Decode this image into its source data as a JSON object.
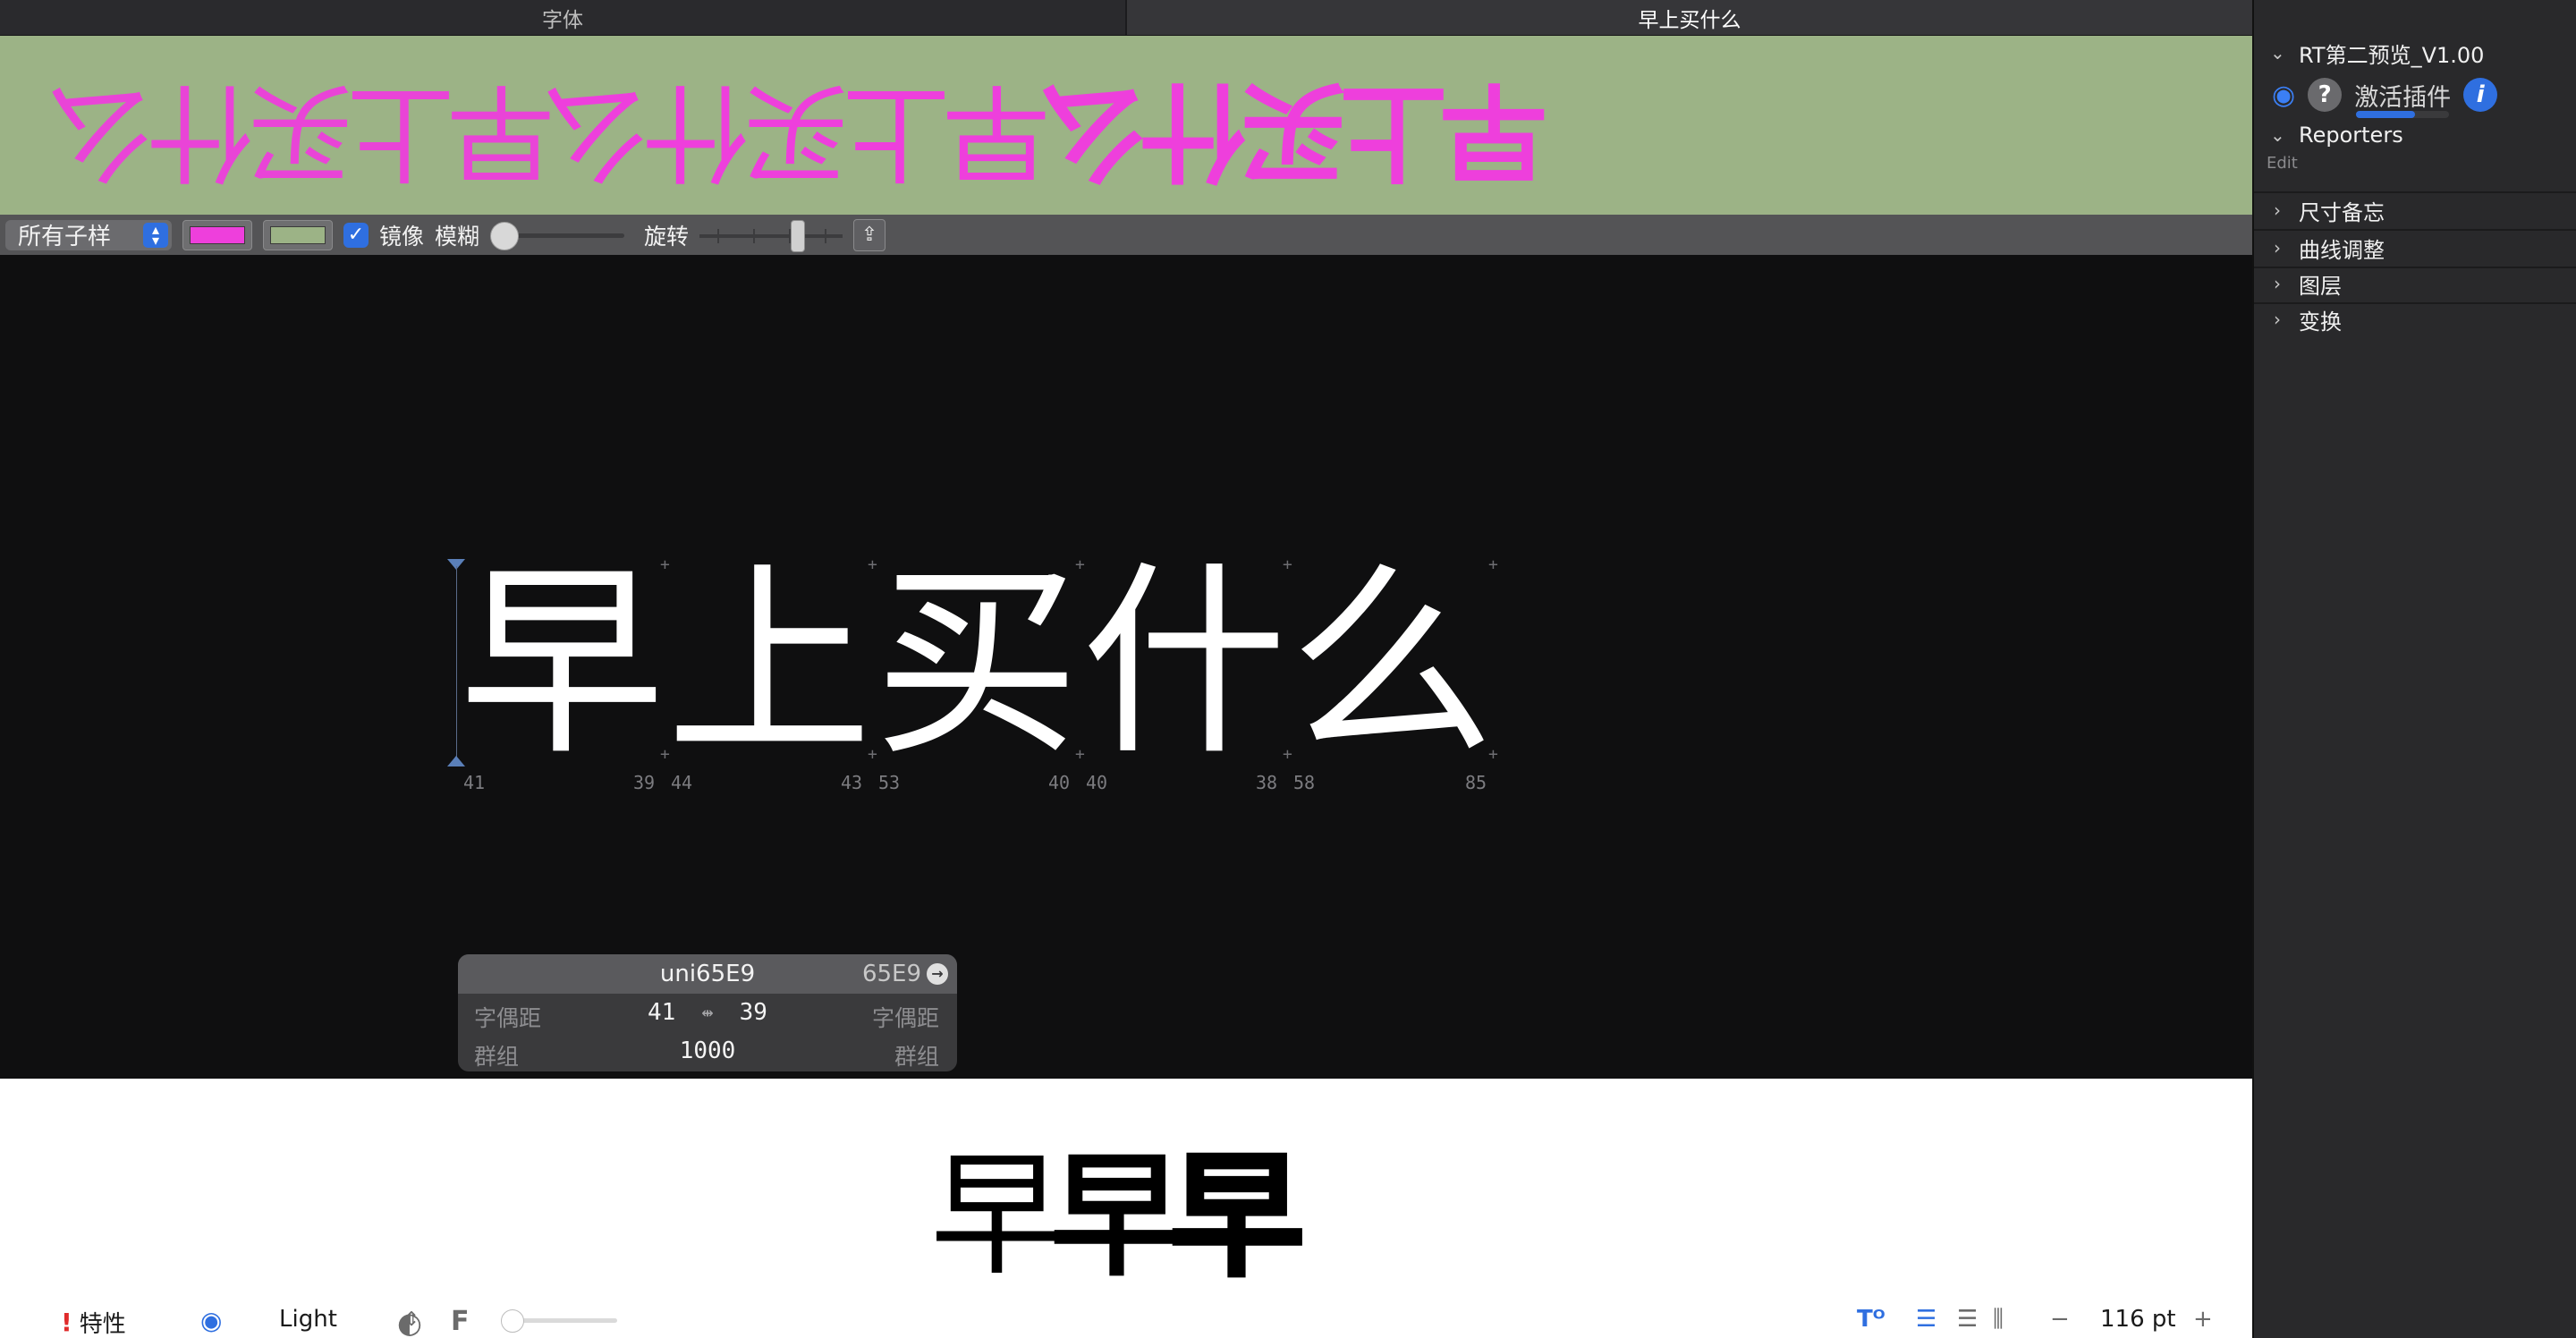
{
  "tabs": [
    {
      "label": "字体"
    },
    {
      "label": "早上买什么"
    }
  ],
  "preview": {
    "text": [
      "早",
      "上",
      "买",
      "什",
      "么"
    ],
    "fg_color": "#ee3fdc",
    "bg_color": "#9cb386"
  },
  "controls": {
    "subfamily_select": "所有子样",
    "mirror_checkbox": "镜像",
    "blur_label": "模糊",
    "rotate_label": "旋转",
    "share_icon": "share-icon"
  },
  "canvas": {
    "glyphs": [
      "早",
      "上",
      "买",
      "什",
      "么"
    ],
    "sidebearings": [
      "41",
      "39",
      "44",
      "43",
      "53",
      "40",
      "40",
      "38",
      "58",
      "85"
    ]
  },
  "glyph_info": {
    "name": "uni65E9",
    "code": "65E9",
    "kerning_left_label": "字偶距",
    "kerning_right_label": "字偶距",
    "left_value": "41",
    "right_value": "39",
    "group_left_label": "群组",
    "group_right_label": "群组",
    "width": "1000"
  },
  "samples": {
    "glyph": "早"
  },
  "statusbar": {
    "features_label": "特性",
    "instance_select": "Light",
    "font_size": "116 pt",
    "minus": "−",
    "plus": "+"
  },
  "sidebar": {
    "plugin_title": "RT第二预览_V1.00",
    "activate_label": "激活插件",
    "reporters_title": "Reporters",
    "edit_label": "Edit",
    "sections": [
      "尺寸备忘",
      "曲线调整",
      "图层",
      "变换"
    ]
  }
}
